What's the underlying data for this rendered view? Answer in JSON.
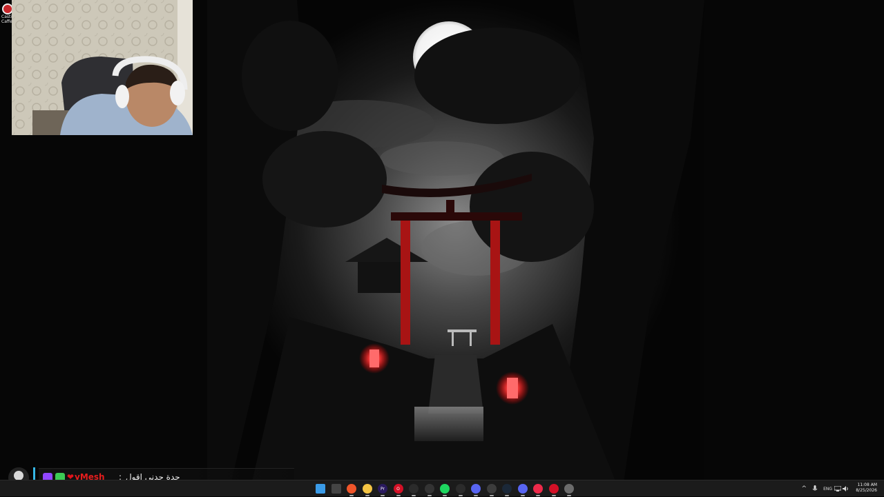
{
  "desktop_icon": {
    "label_line1": "Casti",
    "label_line2": "Caffe"
  },
  "chat": {
    "username": "yMesh_",
    "separator": ":",
    "message": "جدة جدني اقول"
  },
  "taskbar": {
    "apps": [
      {
        "name": "start",
        "icon": "windows-logo-icon",
        "color": "#3a9be8",
        "glyph": ""
      },
      {
        "name": "task-view",
        "icon": "task-view-icon",
        "color": "#444",
        "glyph": ""
      },
      {
        "name": "brave",
        "icon": "brave-icon",
        "color": "#f0552a",
        "glyph": ""
      },
      {
        "name": "file-explorer",
        "icon": "folder-icon",
        "color": "#f4c443",
        "glyph": ""
      },
      {
        "name": "premiere",
        "icon": "premiere-icon",
        "color": "#2a1a5e",
        "glyph": "Pr"
      },
      {
        "name": "opera",
        "icon": "opera-icon",
        "color": "#d31026",
        "glyph": "O"
      },
      {
        "name": "obs",
        "icon": "obs-icon",
        "color": "#2b2b2b",
        "glyph": ""
      },
      {
        "name": "gaming",
        "icon": "gamepad-icon",
        "color": "#333",
        "glyph": ""
      },
      {
        "name": "spotify",
        "icon": "spotify-icon",
        "color": "#1ed760",
        "glyph": ""
      },
      {
        "name": "capcut",
        "icon": "capcut-icon",
        "color": "#2b2b2b",
        "glyph": ""
      },
      {
        "name": "discord",
        "icon": "discord-icon",
        "color": "#5865f2",
        "glyph": ""
      },
      {
        "name": "chrome",
        "icon": "chrome-icon",
        "color": "#3c3c3c",
        "glyph": ""
      },
      {
        "name": "steam",
        "icon": "steam-icon",
        "color": "#1b2838",
        "glyph": ""
      },
      {
        "name": "discord-2",
        "icon": "discord-icon",
        "color": "#5865f2",
        "glyph": ""
      },
      {
        "name": "opera-gx",
        "icon": "opera-gx-icon",
        "color": "#ee2a4a",
        "glyph": ""
      },
      {
        "name": "app-red",
        "icon": "red-app-icon",
        "color": "#d31026",
        "glyph": ""
      },
      {
        "name": "settings",
        "icon": "gear-icon",
        "color": "#6b6b6b",
        "glyph": ""
      }
    ],
    "tray": {
      "chevron": "^",
      "language": "ENG",
      "time": "11:08 AM",
      "date": "8/25/2026"
    }
  }
}
